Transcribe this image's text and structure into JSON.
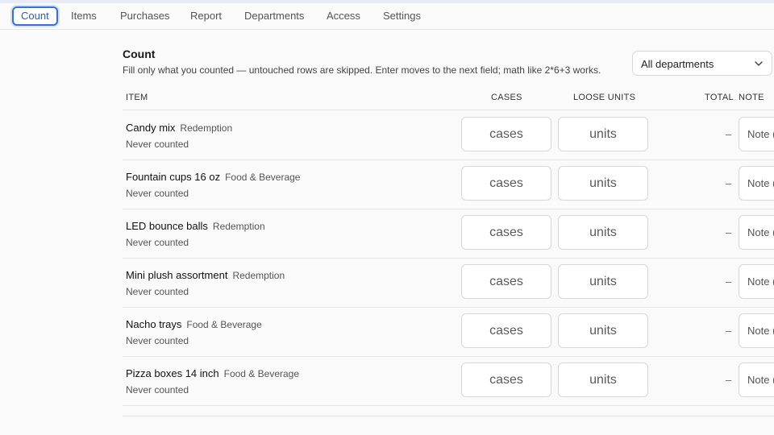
{
  "nav": {
    "tabs": [
      {
        "label": "Count"
      },
      {
        "label": "Items"
      },
      {
        "label": "Purchases"
      },
      {
        "label": "Report"
      },
      {
        "label": "Departments"
      },
      {
        "label": "Access"
      },
      {
        "label": "Settings"
      }
    ],
    "active": "Count"
  },
  "section": {
    "title": "Count",
    "hint": "Fill only what you counted — untouched rows are skipped. Enter moves to the next field; math like 2*6+3 works."
  },
  "filter": {
    "selected": "All departments"
  },
  "columns": {
    "item": "ITEM",
    "cases": "CASES",
    "loose_units": "LOOSE UNITS",
    "total": "TOTAL",
    "note": "NOTE"
  },
  "rows": [
    {
      "name": "Candy mix",
      "department": "Redemption",
      "status": "Never counted",
      "cases_placeholder": "cases",
      "units_placeholder": "units",
      "total": "–",
      "note_placeholder": "Note (optional)"
    },
    {
      "name": "Fountain cups 16 oz",
      "department": "Food & Beverage",
      "status": "Never counted",
      "cases_placeholder": "cases",
      "units_placeholder": "units",
      "total": "–",
      "note_placeholder": "Note (optional)"
    },
    {
      "name": "LED bounce balls",
      "department": "Redemption",
      "status": "Never counted",
      "cases_placeholder": "cases",
      "units_placeholder": "units",
      "total": "–",
      "note_placeholder": "Note (optional)"
    },
    {
      "name": "Mini plush assortment",
      "department": "Redemption",
      "status": "Never counted",
      "cases_placeholder": "cases",
      "units_placeholder": "units",
      "total": "–",
      "note_placeholder": "Note (optional)"
    },
    {
      "name": "Nacho trays",
      "department": "Food & Beverage",
      "status": "Never counted",
      "cases_placeholder": "cases",
      "units_placeholder": "units",
      "total": "–",
      "note_placeholder": "Note (optional)"
    },
    {
      "name": "Pizza boxes 14 inch",
      "department": "Food & Beverage",
      "status": "Never counted",
      "cases_placeholder": "cases",
      "units_placeholder": "units",
      "total": "–",
      "note_placeholder": "Note (optional)"
    }
  ],
  "colors": {
    "accent": "#3a6fd8",
    "background": "#fafafa",
    "border": "#d8d8d8"
  }
}
